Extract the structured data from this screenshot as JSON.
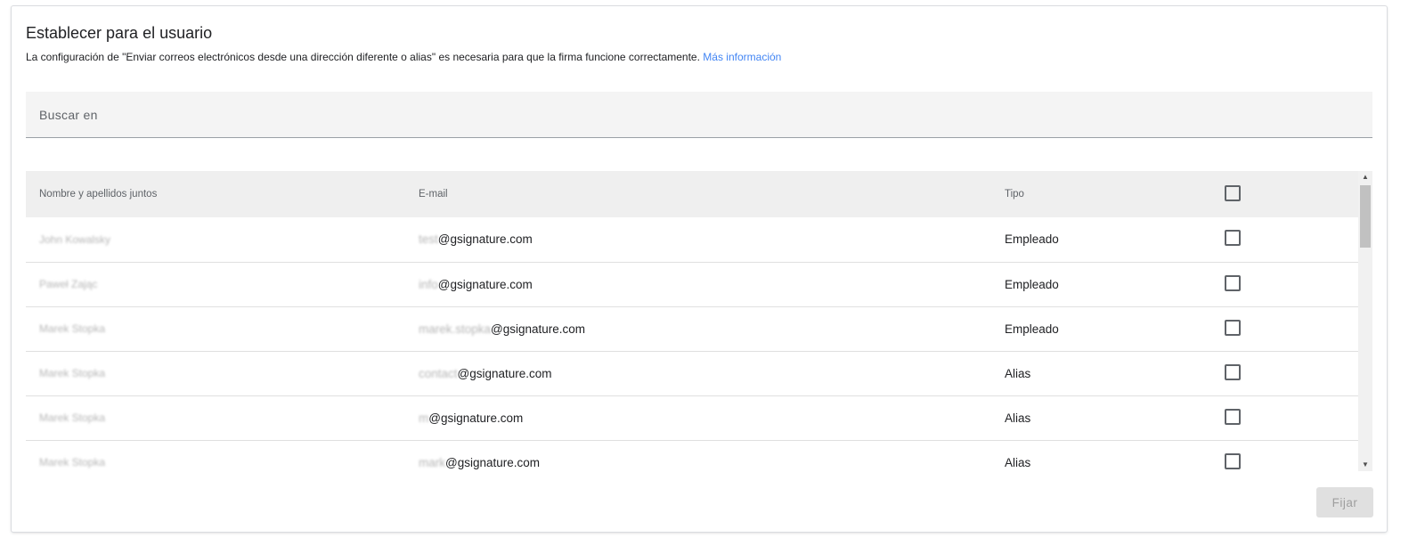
{
  "dialog": {
    "title": "Establecer para el usuario",
    "subtitle": "La configuración de \"Enviar correos electrónicos desde una dirección diferente o alias\" es necesaria para que la firma funcione correctamente.",
    "link_label": "Más información"
  },
  "search": {
    "placeholder": "Buscar en"
  },
  "table": {
    "columns": {
      "name": "Nombre y apellidos juntos",
      "email": "E-mail",
      "type": "Tipo"
    },
    "rows": [
      {
        "name": "John Kowalsky",
        "email_local": "test",
        "email_domain": "@gsignature.com",
        "type": "Empleado",
        "checked": false
      },
      {
        "name": "Paweł Zając",
        "email_local": "info",
        "email_domain": "@gsignature.com",
        "type": "Empleado",
        "checked": false
      },
      {
        "name": "Marek Stopka",
        "email_local": "marek.stopka",
        "email_domain": "@gsignature.com",
        "type": "Empleado",
        "checked": false
      },
      {
        "name": "Marek Stopka",
        "email_local": "contact",
        "email_domain": "@gsignature.com",
        "type": "Alias",
        "checked": false
      },
      {
        "name": "Marek Stopka",
        "email_local": "m",
        "email_domain": "@gsignature.com",
        "type": "Alias",
        "checked": false
      },
      {
        "name": "Marek Stopka",
        "email_local": "mark",
        "email_domain": "@gsignature.com",
        "type": "Alias",
        "checked": false
      }
    ]
  },
  "actions": {
    "apply_label": "Fijar"
  },
  "colors": {
    "link": "#4285f4",
    "header_bg": "#efefef",
    "search_bg": "#f4f4f4",
    "button_bg": "#e0e0e0"
  },
  "icons": {
    "scroll_up": "▲",
    "scroll_down": "▼"
  }
}
